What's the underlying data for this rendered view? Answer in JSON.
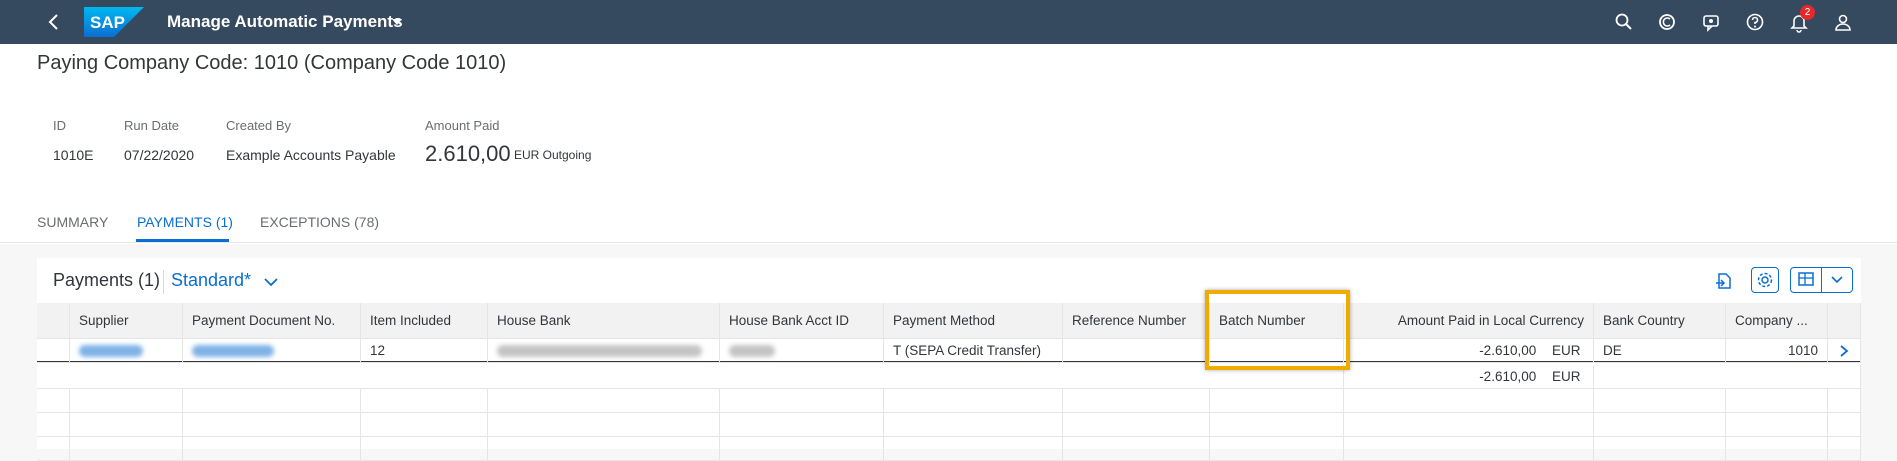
{
  "shell": {
    "app_title": "Manage Automatic Payments",
    "logo_text": "SAP",
    "notification_count": "2",
    "icons": [
      "back-icon",
      "search-icon",
      "copilot-icon",
      "feedback-icon",
      "help-icon",
      "notifications-icon",
      "user-icon"
    ]
  },
  "header": {
    "title": "Paying Company Code: 1010 (Company Code 1010)",
    "id_label": "ID",
    "id_value": "1010E",
    "run_date_label": "Run Date",
    "run_date_value": "07/22/2020",
    "created_by_label": "Created By",
    "created_by_value": "Example Accounts Payable",
    "amount_paid_label": "Amount Paid",
    "amount_paid_value": "2.610,00",
    "amount_paid_unit": "EUR Outgoing"
  },
  "tabs": [
    {
      "label": "SUMMARY",
      "active": false
    },
    {
      "label": "PAYMENTS (1)",
      "active": true
    },
    {
      "label": "EXCEPTIONS (78)",
      "active": false
    }
  ],
  "table": {
    "title": "Payments (1)",
    "variant": "Standard*",
    "toolbar_icons": [
      "export-icon",
      "settings-icon",
      "table-view-icon",
      "dropdown-icon"
    ],
    "columns": [
      "Supplier",
      "Payment Document No.",
      "Item Included",
      "House Bank",
      "House Bank Acct ID",
      "Payment Method",
      "Reference Number",
      "Batch Number",
      "Amount Paid in Local Currency",
      "Bank Country",
      "Company ..."
    ],
    "rows": [
      {
        "item_included": "12",
        "payment_method": "T (SEPA Credit Transfer)",
        "reference_number": "",
        "batch_number": "",
        "amount": "-2.610,00",
        "currency": "EUR",
        "bank_country": "DE",
        "company": "1010"
      }
    ],
    "total": {
      "amount": "-2.610,00",
      "currency": "EUR"
    }
  },
  "colors": {
    "shell_bg": "#354a5f",
    "accent": "#0a6ed1",
    "highlight": "#f0ab00",
    "badge": "#e52929"
  }
}
